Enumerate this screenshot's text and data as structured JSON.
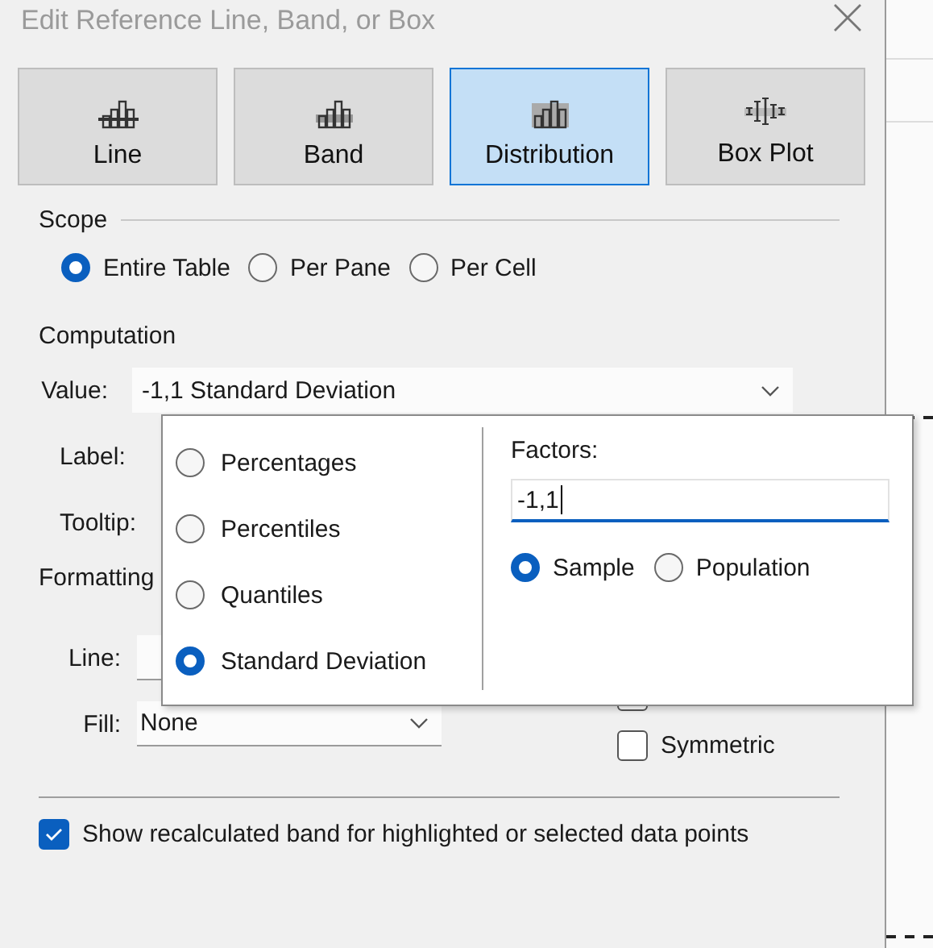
{
  "window": {
    "title": "Edit Reference Line, Band, or Box"
  },
  "types": [
    {
      "label": "Line",
      "kind": "line",
      "selected": false
    },
    {
      "label": "Band",
      "kind": "band",
      "selected": false
    },
    {
      "label": "Distribution",
      "kind": "distribution",
      "selected": true
    },
    {
      "label": "Box Plot",
      "kind": "boxplot",
      "selected": false
    }
  ],
  "scope": {
    "heading": "Scope",
    "options": [
      {
        "label": "Entire Table",
        "selected": true
      },
      {
        "label": "Per Pane",
        "selected": false
      },
      {
        "label": "Per Cell",
        "selected": false
      }
    ]
  },
  "computation": {
    "heading": "Computation",
    "value_label": "Value:",
    "value": "-1,1 Standard Deviation",
    "label_label": "Label:",
    "tooltip_label": "Tooltip:"
  },
  "formatting": {
    "heading": "Formatting",
    "line_label": "Line:",
    "fill_label": "Fill:",
    "fill_value": "None",
    "fill_below": {
      "checked": false
    },
    "symmetric": {
      "label": "Symmetric",
      "checked": false
    }
  },
  "recalculated": {
    "label": "Show recalculated band for highlighted or selected data points",
    "checked": true
  },
  "popup": {
    "methods": [
      {
        "label": "Percentages",
        "selected": false
      },
      {
        "label": "Percentiles",
        "selected": false
      },
      {
        "label": "Quantiles",
        "selected": false
      },
      {
        "label": "Standard Deviation",
        "selected": true
      }
    ],
    "factors_label": "Factors:",
    "factors_value": "-1,1",
    "sample_options": [
      {
        "label": "Sample",
        "selected": true
      },
      {
        "label": "Population",
        "selected": false
      }
    ]
  }
}
